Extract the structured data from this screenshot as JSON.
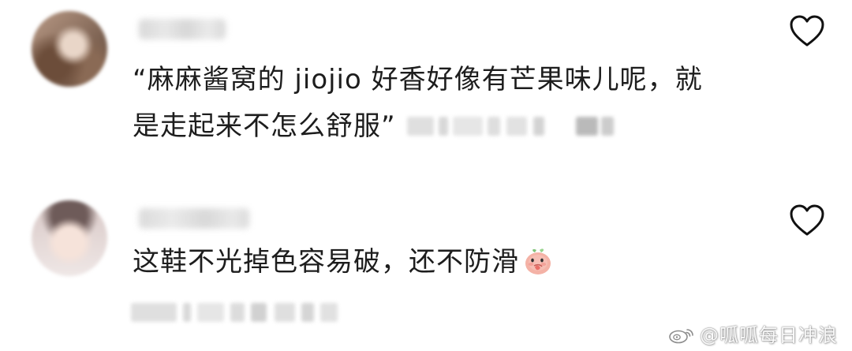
{
  "comments": [
    {
      "text_line_1": "“麻麻酱窝的 jiojio 好香好像有芒果味儿呢，就",
      "text_line_2": "是走起来不怎么舒服”"
    },
    {
      "text": "这鞋不光掉色容易破，还不防滑"
    }
  ],
  "emoji_name": "peach-hand-over-mouth-emoji",
  "icons": {
    "like": "heart-icon",
    "watermark": "weibo-logo-icon"
  },
  "watermark": {
    "text": "@呱呱每日冲浪"
  },
  "colors": {
    "text": "#1d1d1d",
    "heart_stroke": "#111111",
    "background": "#ffffff"
  }
}
